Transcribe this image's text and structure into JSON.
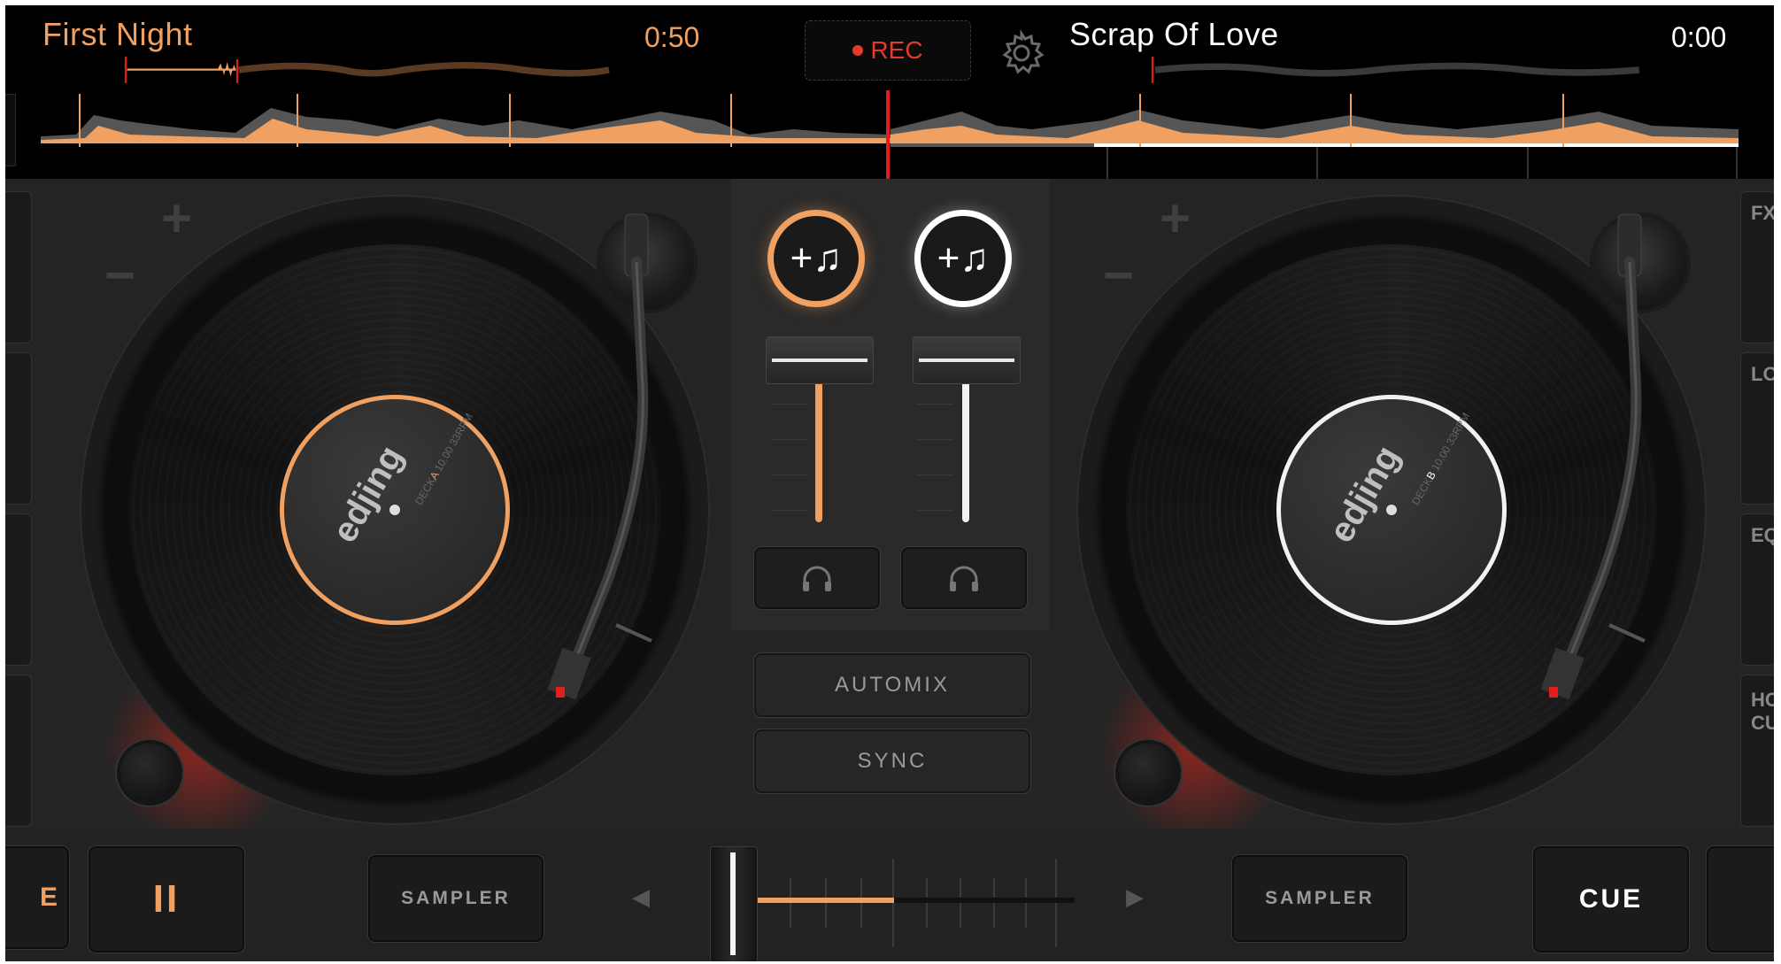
{
  "deck_a": {
    "track_title": "First Night",
    "time": "0:50",
    "brand": "edjing",
    "caption_prefix": "DECK",
    "caption_letter": "A",
    "caption_suffix": " 10.00 33RPM"
  },
  "deck_b": {
    "track_title": "Scrap Of Love",
    "time": "0:00",
    "brand": "edjing",
    "caption_prefix": "DECK",
    "caption_letter": "B",
    "caption_suffix": " 10.00 33RPM"
  },
  "header": {
    "rec_label": "REC"
  },
  "mixer": {
    "automix_label": "AUTOMIX",
    "sync_label": "SYNC",
    "load_a_icon": "+♫",
    "load_b_icon": "+♫"
  },
  "side_panel_right": {
    "labels": [
      "FX",
      "LO",
      "EQ",
      "HC",
      "CU"
    ]
  },
  "bottom": {
    "left_edge_label": "E",
    "pause_label": "II",
    "sampler_left_label": "SAMPLER",
    "sampler_right_label": "SAMPLER",
    "cue_label": "CUE"
  },
  "colors": {
    "deck_a_accent": "#f0a060",
    "deck_b_accent": "#ffffff",
    "rec_red": "#e23b2c",
    "playhead_red": "#e11d1d",
    "background": "#242424"
  },
  "icons": [
    "gear-icon",
    "headphones-icon",
    "music-note-add-icon",
    "pause-icon",
    "arrow-left-icon",
    "arrow-right-icon"
  ]
}
